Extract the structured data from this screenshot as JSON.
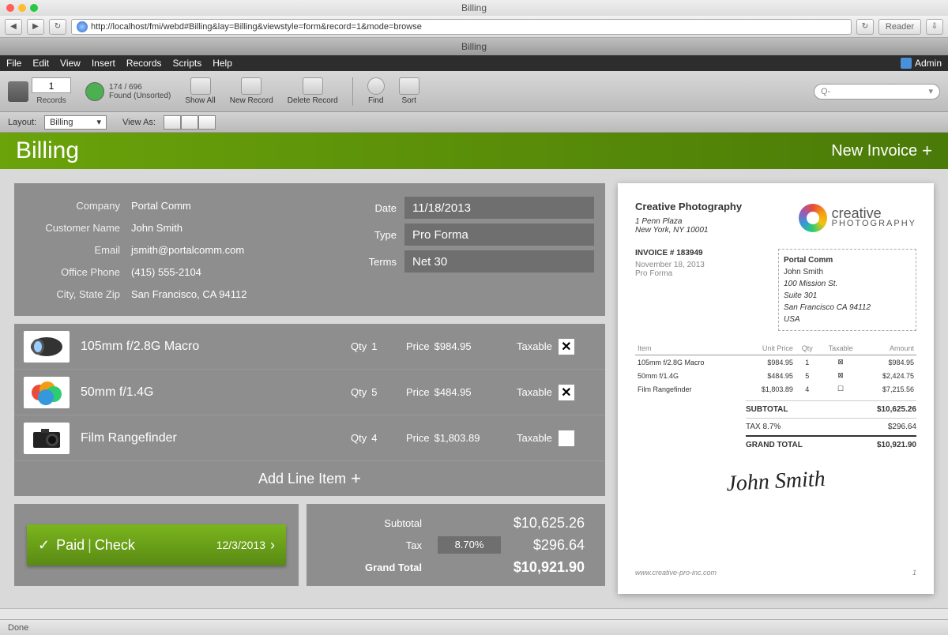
{
  "window": {
    "title": "Billing"
  },
  "browser": {
    "url": "http://localhost/fmi/webd#Billing&lay=Billing&viewstyle=form&record=1&mode=browse",
    "reader_label": "Reader",
    "tab_label": "Billing"
  },
  "menubar": {
    "items": [
      "File",
      "Edit",
      "View",
      "Insert",
      "Records",
      "Scripts",
      "Help"
    ],
    "user": "Admin"
  },
  "toolbar": {
    "record_number": "1",
    "found": "174 / 696",
    "found_sub": "Found (Unsorted)",
    "records_label": "Records",
    "show_all": "Show All",
    "new_record": "New Record",
    "delete_record": "Delete Record",
    "find": "Find",
    "sort": "Sort",
    "search_placeholder": "Q-"
  },
  "layoutbar": {
    "layout_label": "Layout:",
    "layout_value": "Billing",
    "viewas_label": "View As:"
  },
  "header": {
    "title": "Billing",
    "new_invoice": "New Invoice"
  },
  "customer": {
    "labels": {
      "company": "Company",
      "name": "Customer Name",
      "email": "Email",
      "phone": "Office Phone",
      "citystate": "City, State Zip",
      "date": "Date",
      "type": "Type",
      "terms": "Terms"
    },
    "company": "Portal Comm",
    "name": "John Smith",
    "email": "jsmith@portalcomm.com",
    "phone": "(415) 555-2104",
    "citystate": "San Francisco, CA 94112",
    "date": "11/18/2013",
    "type": "Pro Forma",
    "terms": "Net 30"
  },
  "lines": {
    "qty_label": "Qty",
    "price_label": "Price",
    "taxable_label": "Taxable",
    "items": [
      {
        "name": "105mm f/2.8G Macro",
        "qty": "1",
        "price": "$984.95",
        "taxable": true
      },
      {
        "name": "50mm f/1.4G",
        "qty": "5",
        "price": "$484.95",
        "taxable": true
      },
      {
        "name": "Film Rangefinder",
        "qty": "4",
        "price": "$1,803.89",
        "taxable": false
      }
    ],
    "add_label": "Add Line Item"
  },
  "paid": {
    "label": "Paid",
    "method": "Check",
    "date": "12/3/2013"
  },
  "totals": {
    "subtotal_label": "Subtotal",
    "subtotal": "$10,625.26",
    "tax_label": "Tax",
    "tax_rate": "8.70%",
    "tax": "$296.64",
    "grand_label": "Grand Total",
    "grand": "$10,921.90"
  },
  "invoice": {
    "company": "Creative Photography",
    "addr1": "1 Penn Plaza",
    "addr2": "New York, NY 10001",
    "logo_main": "creative",
    "logo_sub": "PHOTOGRAPHY",
    "number_label": "INVOICE # 183949",
    "date": "November 18, 2013",
    "type": "Pro Forma",
    "bill_to": {
      "company": "Portal Comm",
      "name": "John Smith",
      "street": "100 Mission St.",
      "suite": "Suite 301",
      "citystate": "San Francisco CA 94112",
      "country": "USA"
    },
    "cols": {
      "item": "Item",
      "unitprice": "Unit Price",
      "qty": "Qty",
      "taxable": "Taxable",
      "amount": "Amount"
    },
    "rows": [
      {
        "item": "105mm f/2.8G Macro",
        "unit": "$984.95",
        "qty": "1",
        "tax": "⊠",
        "amount": "$984.95"
      },
      {
        "item": "50mm f/1.4G",
        "unit": "$484.95",
        "qty": "5",
        "tax": "⊠",
        "amount": "$2,424.75"
      },
      {
        "item": "Film Rangefinder",
        "unit": "$1,803.89",
        "qty": "4",
        "tax": "☐",
        "amount": "$7,215.56"
      }
    ],
    "subtotal_label": "SUBTOTAL",
    "subtotal": "$10,625.26",
    "taxline_label": "TAX  8.7%",
    "tax": "$296.64",
    "grand_label": "GRAND TOTAL",
    "grand": "$10,921.90",
    "signature": "John Smith",
    "footer": "www.creative-pro-inc.com",
    "page": "1"
  },
  "status": {
    "done": "Done"
  }
}
